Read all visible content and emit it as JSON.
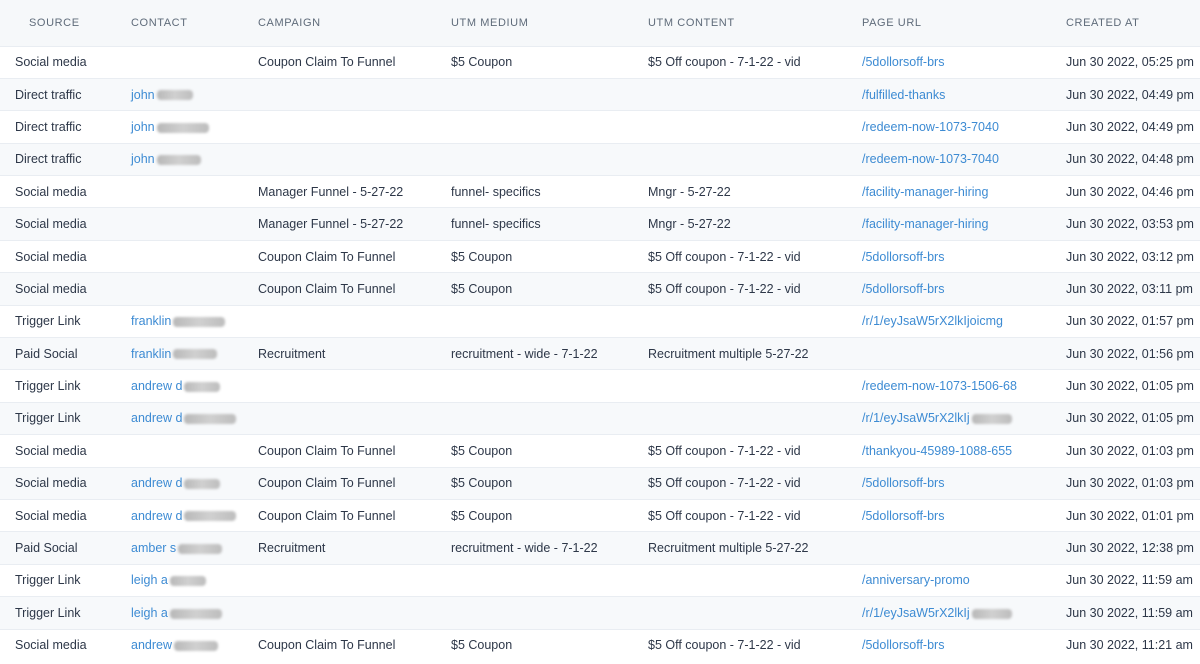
{
  "headers": {
    "source": "SOURCE",
    "contact": "CONTACT",
    "campaign": "CAMPAIGN",
    "utm_medium": "UTM MEDIUM",
    "utm_content": "UTM CONTENT",
    "page_url": "PAGE URL",
    "created_at": "CREATED AT"
  },
  "rows": [
    {
      "source": "Social media",
      "contact": "",
      "campaign": "Coupon Claim To Funnel",
      "medium": "$5 Coupon",
      "content": "$5 Off coupon - 7-1-22 - vid",
      "url": "/5dollorsoff-brs",
      "created": "Jun 30 2022, 05:25 pm"
    },
    {
      "source": "Direct traffic",
      "contact": "john",
      "campaign": "",
      "medium": "",
      "content": "",
      "url": "/fulfilled-thanks",
      "created": "Jun 30 2022, 04:49 pm"
    },
    {
      "source": "Direct traffic",
      "contact": "john",
      "campaign": "",
      "medium": "",
      "content": "",
      "url": "/redeem-now-1073-7040",
      "created": "Jun 30 2022, 04:49 pm"
    },
    {
      "source": "Direct traffic",
      "contact": "john",
      "campaign": "",
      "medium": "",
      "content": "",
      "url": "/redeem-now-1073-7040",
      "created": "Jun 30 2022, 04:48 pm"
    },
    {
      "source": "Social media",
      "contact": "",
      "campaign": "Manager Funnel - 5-27-22",
      "medium": "funnel- specifics",
      "content": "Mngr - 5-27-22",
      "url": "/facility-manager-hiring",
      "created": "Jun 30 2022, 04:46 pm"
    },
    {
      "source": "Social media",
      "contact": "",
      "campaign": "Manager Funnel - 5-27-22",
      "medium": "funnel- specifics",
      "content": "Mngr - 5-27-22",
      "url": "/facility-manager-hiring",
      "created": "Jun 30 2022, 03:53 pm"
    },
    {
      "source": "Social media",
      "contact": "",
      "campaign": "Coupon Claim To Funnel",
      "medium": "$5 Coupon",
      "content": "$5 Off coupon - 7-1-22 - vid",
      "url": "/5dollorsoff-brs",
      "created": "Jun 30 2022, 03:12 pm"
    },
    {
      "source": "Social media",
      "contact": "",
      "campaign": "Coupon Claim To Funnel",
      "medium": "$5 Coupon",
      "content": "$5 Off coupon - 7-1-22 - vid",
      "url": "/5dollorsoff-brs",
      "created": "Jun 30 2022, 03:11 pm"
    },
    {
      "source": "Trigger Link",
      "contact": "franklin",
      "campaign": "",
      "medium": "",
      "content": "",
      "url": "/r/1/eyJsaW5rX2lkIjoicmg",
      "created": "Jun 30 2022, 01:57 pm"
    },
    {
      "source": "Paid Social",
      "contact": "franklin",
      "campaign": "Recruitment",
      "medium": "recruitment - wide - 7-1-22",
      "content": "Recruitment multiple 5-27-22",
      "url": "",
      "created": "Jun 30 2022, 01:56 pm"
    },
    {
      "source": "Trigger Link",
      "contact": "andrew d",
      "campaign": "",
      "medium": "",
      "content": "",
      "url": "/redeem-now-1073-1506-68",
      "created": "Jun 30 2022, 01:05 pm"
    },
    {
      "source": "Trigger Link",
      "contact": "andrew d",
      "campaign": "",
      "medium": "",
      "content": "",
      "url": "/r/1/eyJsaW5rX2lkIj",
      "created": "Jun 30 2022, 01:05 pm"
    },
    {
      "source": "Social media",
      "contact": "",
      "campaign": "Coupon Claim To Funnel",
      "medium": "$5 Coupon",
      "content": "$5 Off coupon - 7-1-22 - vid",
      "url": "/thankyou-45989-1088-655",
      "created": "Jun 30 2022, 01:03 pm"
    },
    {
      "source": "Social media",
      "contact": "andrew d",
      "campaign": "Coupon Claim To Funnel",
      "medium": "$5 Coupon",
      "content": "$5 Off coupon - 7-1-22 - vid",
      "url": "/5dollorsoff-brs",
      "created": "Jun 30 2022, 01:03 pm"
    },
    {
      "source": "Social media",
      "contact": "andrew d",
      "campaign": "Coupon Claim To Funnel",
      "medium": "$5 Coupon",
      "content": "$5 Off coupon - 7-1-22 - vid",
      "url": "/5dollorsoff-brs",
      "created": "Jun 30 2022, 01:01 pm"
    },
    {
      "source": "Paid Social",
      "contact": "amber s",
      "campaign": "Recruitment",
      "medium": "recruitment - wide - 7-1-22",
      "content": "Recruitment multiple 5-27-22",
      "url": "",
      "created": "Jun 30 2022, 12:38 pm"
    },
    {
      "source": "Trigger Link",
      "contact": "leigh a",
      "campaign": "",
      "medium": "",
      "content": "",
      "url": "/anniversary-promo",
      "created": "Jun 30 2022, 11:59 am"
    },
    {
      "source": "Trigger Link",
      "contact": "leigh a",
      "campaign": "",
      "medium": "",
      "content": "",
      "url": "/r/1/eyJsaW5rX2lkIj",
      "created": "Jun 30 2022, 11:59 am"
    },
    {
      "source": "Social media",
      "contact": "andrew",
      "campaign": "Coupon Claim To Funnel",
      "medium": "$5 Coupon",
      "content": "$5 Off coupon - 7-1-22 - vid",
      "url": "/5dollorsoff-brs",
      "created": "Jun 30 2022, 11:21 am"
    }
  ]
}
